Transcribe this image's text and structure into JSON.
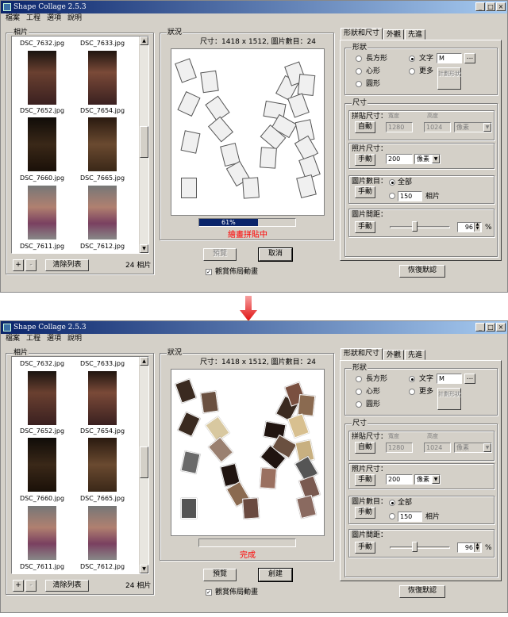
{
  "app_title": "Shape Collage 2.5.3",
  "window_buttons": [
    "_",
    "□",
    "×"
  ],
  "menu": [
    "檔案",
    "工程",
    "選項",
    "說明"
  ],
  "photos_group_title": "相片",
  "photo_list": [
    {
      "left": "DSC_7632.jpg",
      "right": "DSC_7633.jpg"
    },
    {
      "left": "DSC_7652.jpg",
      "right": "DSC_7654.jpg"
    },
    {
      "left": "DSC_7660.jpg",
      "right": "DSC_7665.jpg"
    },
    {
      "left": "DSC_7611.jpg",
      "right": "DSC_7612.jpg"
    }
  ],
  "add_label": "+",
  "remove_label": "-",
  "clear_list_label": "清除列表",
  "photo_count": "24 相片",
  "status_group_title": "狀況",
  "size_info": "尺寸：1418 x 1512, 圖片數目：24",
  "progress_text": "61%",
  "progress_fraction": 0.61,
  "building_status": "繪畫拼貼中",
  "done_status": "完成",
  "preview_label": "預覽",
  "cancel_label": "取消",
  "create_label": "創建",
  "watch_checkbox_label": "觀賞佈局動畫",
  "tabs": [
    "形狀和尺寸",
    "外觀",
    "先進"
  ],
  "shape_group_title": "形狀",
  "shape_rect": "長方形",
  "shape_heart": "心形",
  "shape_circle": "圓形",
  "shape_text": "文字",
  "shape_more": "更多",
  "text_value": "M",
  "browse_label": "...",
  "draw_shape_label": "計劃形狀",
  "size_group_title": "尺寸",
  "collage_size_label": "拼貼尺寸：",
  "width_label": "寬度",
  "height_label": "高度",
  "auto_label": "自動",
  "width_value": "1280",
  "height_value": "1024",
  "pixel_unit": "像素",
  "photo_size_label": "照片尺寸：",
  "manual_label": "手動",
  "photo_size_value": "200",
  "photo_count_label": "圖片數目：",
  "all_label": "全部",
  "count_value": "150",
  "photos_unit": "相片",
  "spacing_label": "圖片間距：",
  "spacing_value": "96",
  "percent": "%",
  "restore_defaults": "恢復默認"
}
